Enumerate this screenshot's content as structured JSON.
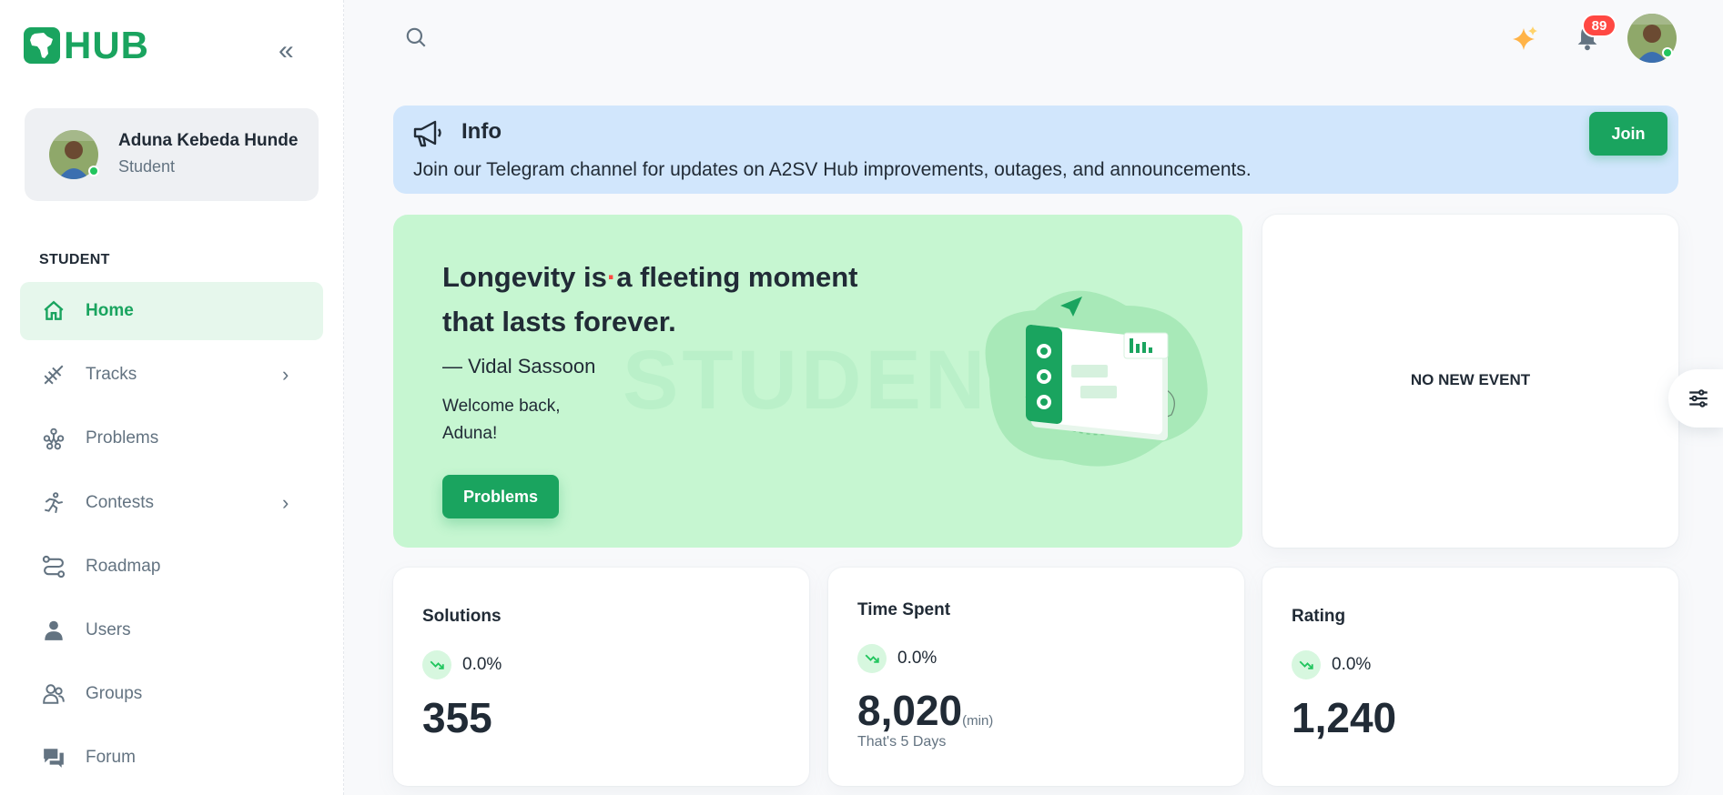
{
  "brand": {
    "logo_text": "HUB",
    "accent": "#1aa45f"
  },
  "user": {
    "name": "Aduna Kebeda Hunde",
    "role": "Student"
  },
  "sidebar": {
    "section_label": "STUDENT",
    "items": [
      {
        "label": "Home",
        "icon": "home-icon",
        "active": true
      },
      {
        "label": "Tracks",
        "icon": "tracks-icon",
        "has_submenu": true
      },
      {
        "label": "Problems",
        "icon": "problems-icon"
      },
      {
        "label": "Contests",
        "icon": "contests-icon",
        "has_submenu": true
      },
      {
        "label": "Roadmap",
        "icon": "roadmap-icon"
      },
      {
        "label": "Users",
        "icon": "users-icon"
      },
      {
        "label": "Groups",
        "icon": "groups-icon"
      },
      {
        "label": "Forum",
        "icon": "forum-icon"
      }
    ]
  },
  "header": {
    "notifications_count": "89"
  },
  "info": {
    "title": "Info",
    "text": "Join our Telegram channel for updates on A2SV Hub improvements, outages, and announcements.",
    "button": "Join"
  },
  "hero": {
    "quote_line1_start": "Longevity is",
    "quote_line1_end": "a fleeting moment",
    "quote_line2": "that lasts forever.",
    "author": "— Vidal Sassoon",
    "welcome": "Welcome back, Aduna!",
    "watermark": "STUDENT",
    "button": "Problems"
  },
  "events": {
    "empty_text": "NO NEW EVENT"
  },
  "stats": [
    {
      "title": "Solutions",
      "trend": "0.0%",
      "value": "355"
    },
    {
      "title": "Time Spent",
      "trend": "0.0%",
      "value": "8,020",
      "unit": "(min)",
      "sub": "That's 5 Days"
    },
    {
      "title": "Rating",
      "trend": "0.0%",
      "value": "1,240"
    }
  ]
}
